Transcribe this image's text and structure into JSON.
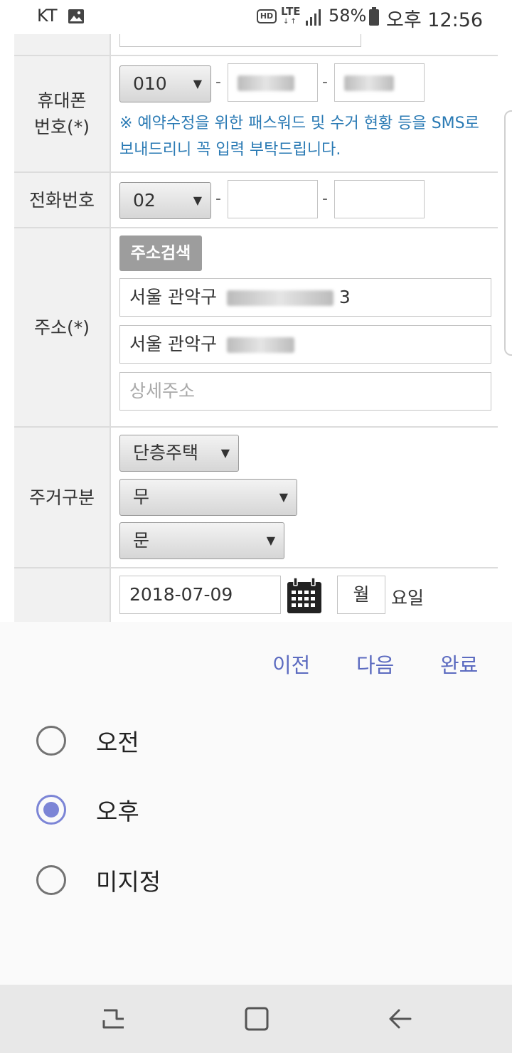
{
  "status_bar": {
    "carrier": "KT",
    "hd": "HD",
    "network": "LTE",
    "battery": "58%",
    "time": "오후 12:56",
    "icons": [
      "gallery-icon",
      "hd-voice-icon",
      "lte-icon",
      "signal-icon",
      "battery-icon"
    ]
  },
  "form": {
    "mobile": {
      "label": "휴대폰\n번호(*)",
      "prefix": "010",
      "dash": "-",
      "notice": "※ 예약수정을 위한 패스워드 및 수거 현황 등을 SMS로 보내드리니 꼭 입력 부탁드립니다."
    },
    "phone": {
      "label": "전화번호",
      "prefix": "02",
      "dash": "-",
      "middle": "",
      "last": ""
    },
    "address": {
      "label": "주소(*)",
      "search_button": "주소검색",
      "line1_prefix": "서울 관악구",
      "line1_suffix": "3",
      "line2_prefix": "서울 관악구",
      "detail_placeholder": "상세주소"
    },
    "housing": {
      "label": "주거구분",
      "type": "단층주택",
      "option2": "무",
      "option3": "문"
    },
    "date": {
      "value": "2018-07-09",
      "weekday": "월",
      "weekday_suffix": "요일"
    }
  },
  "picker": {
    "prev": "이전",
    "next": "다음",
    "done": "완료",
    "options": [
      {
        "label": "오전",
        "checked": false
      },
      {
        "label": "오후",
        "checked": true
      },
      {
        "label": "미지정",
        "checked": false
      }
    ]
  },
  "nav": {
    "buttons": [
      "recent-apps-icon",
      "home-icon",
      "back-icon"
    ]
  },
  "colors": {
    "accent": "#5c6bc0",
    "radio": "#7c85d6",
    "notice": "#2a7ab4",
    "label_bg": "#f1f1f1",
    "button_gray": "#9d9d9d"
  }
}
